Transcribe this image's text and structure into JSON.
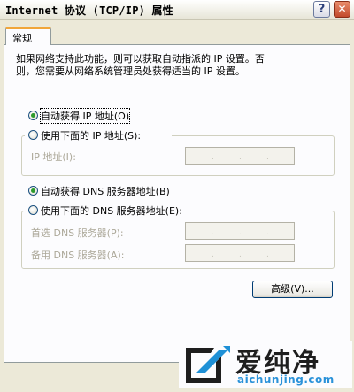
{
  "window": {
    "title": "Internet 协议 (TCP/IP) 属性",
    "help_label": "?",
    "close_label": "✕"
  },
  "tabs": [
    {
      "label": "常规"
    }
  ],
  "description": {
    "line1": "如果网络支持此功能，则可以获取自动指派的 IP 设置。否",
    "line2": "则，您需要从网络系统管理员处获得适当的 IP 设置。"
  },
  "ip": {
    "auto_label": "自动获得 IP 地址(O)",
    "auto_selected": true,
    "manual_label": "使用下面的 IP 地址(S):",
    "address_label": "IP 地址(I):"
  },
  "dns": {
    "auto_label": "自动获得 DNS 服务器地址(B)",
    "auto_selected": true,
    "manual_label": "使用下面的 DNS 服务器地址(E):",
    "preferred_label": "首选 DNS 服务器(P):",
    "alternate_label": "备用 DNS 服务器(A):"
  },
  "buttons": {
    "advanced_label": "高级(V)..."
  },
  "watermark": {
    "name_cn": "爱纯净",
    "domain": "aichunjing.com"
  }
}
